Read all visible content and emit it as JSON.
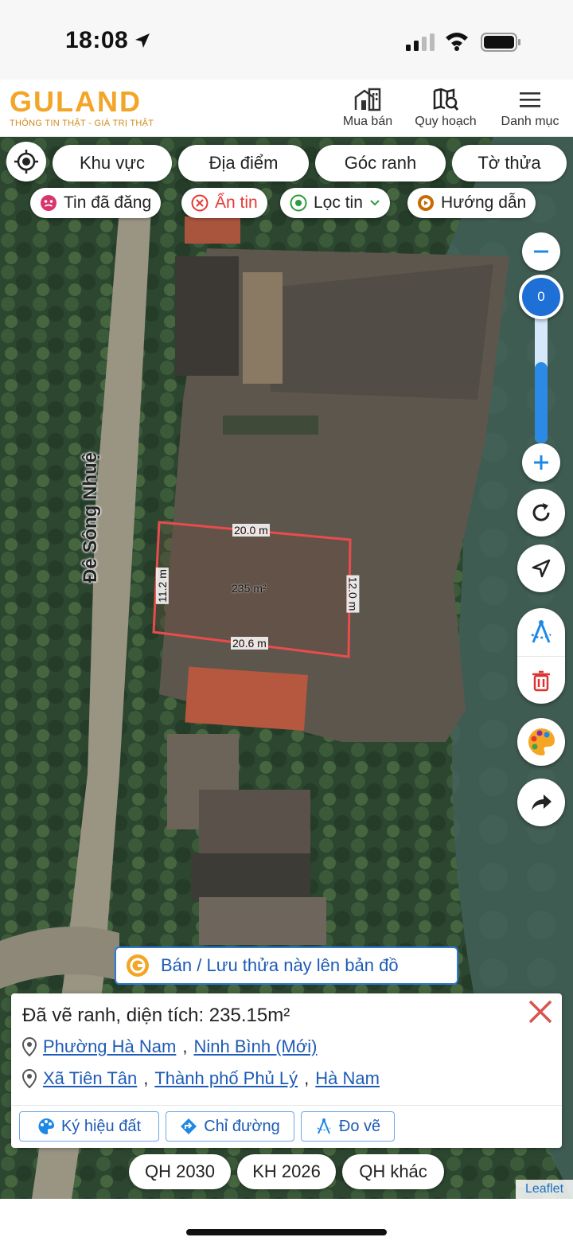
{
  "status_bar": {
    "time": "18:08"
  },
  "header": {
    "brand": "GULAND",
    "tagline": "THÔNG TIN THẬT - GIÁ TRỊ THẬT",
    "nav": [
      {
        "label": "Mua bán",
        "icon": "building-icon"
      },
      {
        "label": "Quy hoạch",
        "icon": "map-search-icon"
      },
      {
        "label": "Danh mục",
        "icon": "hamburger-menu-icon"
      }
    ]
  },
  "filters": {
    "primary": [
      "Khu vực",
      "Địa điểm",
      "Góc ranh",
      "Tờ thửa"
    ],
    "secondary": [
      {
        "label": "Tin đã đăng",
        "icon": "emoji-icon",
        "color": "#d9356b"
      },
      {
        "label": "Ẩn tin",
        "icon": "close-circle-icon",
        "color": "#e53935"
      },
      {
        "label": "Lọc tin",
        "icon": "location-pin-icon",
        "color": "#2e9b3e"
      },
      {
        "label": "Hướng dẫn",
        "icon": "play-circle-icon",
        "color": "#c76b00"
      }
    ]
  },
  "map": {
    "road_label": "Đê Sông Nhuệ",
    "zoom_value": "0",
    "zoom_level": 0.6,
    "parcel": {
      "top": "20.0 m",
      "left": "11.2 m",
      "right": "12.0 m",
      "bottom": "20.6 m",
      "area": "235 m²"
    },
    "accent_color": "#1e88e5",
    "parcel_color": "#e84c4c"
  },
  "save_bar": {
    "label": "Bán / Lưu thửa này lên bản đồ"
  },
  "info_panel": {
    "title": "Đã vẽ ranh, diện tích: 235.15m²",
    "line1": [
      "Phường Hà Nam",
      "Ninh Bình (Mới)"
    ],
    "line2": [
      "Xã Tiên Tân",
      "Thành phố Phủ Lý",
      "Hà Nam"
    ],
    "actions": [
      "Ký hiệu đất",
      "Chỉ đường",
      "Đo vẽ"
    ]
  },
  "plan_buttons": [
    "QH 2030",
    "KH 2026",
    "QH khác"
  ],
  "attribution": "Leaflet"
}
